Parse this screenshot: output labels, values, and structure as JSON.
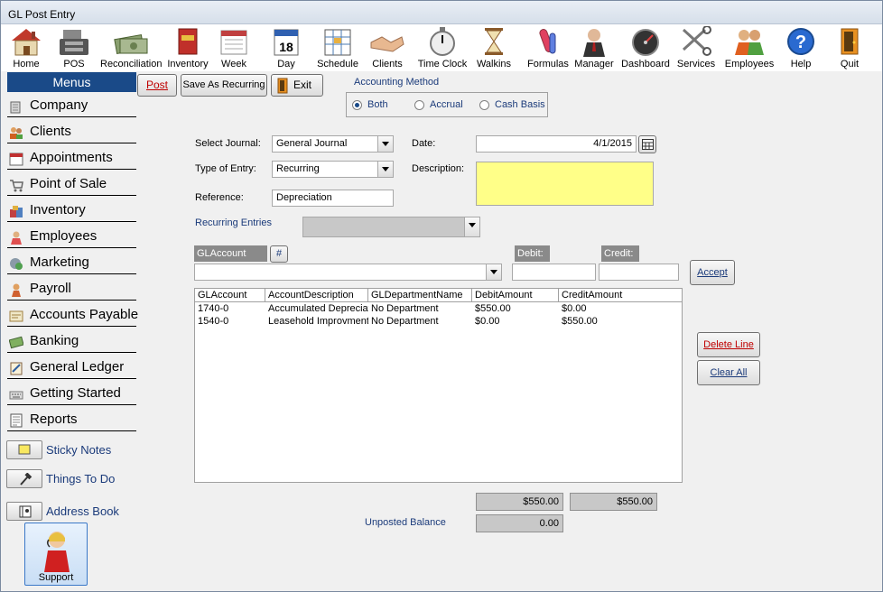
{
  "window": {
    "title": "GL Post Entry"
  },
  "toolbar": [
    {
      "label": "Home",
      "icon": "house-icon"
    },
    {
      "label": "POS",
      "icon": "cash-register-icon"
    },
    {
      "label": "Reconciliation",
      "icon": "money-icon"
    },
    {
      "label": "Inventory",
      "icon": "book-icon"
    },
    {
      "label": "Week",
      "icon": "week-calendar-icon"
    },
    {
      "label": "Day",
      "icon": "day-calendar-icon"
    },
    {
      "label": "Schedule",
      "icon": "schedule-icon"
    },
    {
      "label": "Clients",
      "icon": "handshake-icon"
    },
    {
      "label": "Time Clock",
      "icon": "stopwatch-icon"
    },
    {
      "label": "Walkins",
      "icon": "hourglass-icon"
    },
    {
      "label": "Formulas",
      "icon": "test-tube-icon"
    },
    {
      "label": "Manager",
      "icon": "manager-icon"
    },
    {
      "label": "Dashboard",
      "icon": "gauge-icon"
    },
    {
      "label": "Services",
      "icon": "scissors-icon"
    },
    {
      "label": "Employees",
      "icon": "people-icon"
    },
    {
      "label": "Help",
      "icon": "help-icon"
    },
    {
      "label": "Quit",
      "icon": "door-icon"
    }
  ],
  "sidebar": {
    "header": "Menus",
    "items": [
      {
        "label": "Company",
        "icon": "company-icon"
      },
      {
        "label": "Clients",
        "icon": "clients-icon"
      },
      {
        "label": "Appointments",
        "icon": "appointments-icon"
      },
      {
        "label": "Point of Sale",
        "icon": "cart-icon"
      },
      {
        "label": "Inventory",
        "icon": "inventory-icon"
      },
      {
        "label": "Employees",
        "icon": "employees-icon"
      },
      {
        "label": "Marketing",
        "icon": "marketing-icon"
      },
      {
        "label": "Payroll",
        "icon": "payroll-icon"
      },
      {
        "label": "Accounts Payable",
        "icon": "accounts-payable-icon"
      },
      {
        "label": "Banking",
        "icon": "banking-icon"
      },
      {
        "label": "General Ledger",
        "icon": "ledger-icon"
      },
      {
        "label": "Getting Started",
        "icon": "keyboard-icon"
      },
      {
        "label": "Reports",
        "icon": "reports-icon"
      }
    ],
    "utilities": [
      {
        "label": "Sticky Notes",
        "icon": "sticky-note-icon"
      },
      {
        "label": "Things To Do",
        "icon": "hammer-icon"
      },
      {
        "label": "Address Book",
        "icon": "address-book-icon"
      }
    ],
    "support": "Support"
  },
  "actions": {
    "post": "Post",
    "save_recurring": "Save As Recurring",
    "exit": "Exit"
  },
  "accounting_method": {
    "title": "Accounting Method",
    "options": [
      "Both",
      "Accrual",
      "Cash Basis"
    ],
    "selected": "Both"
  },
  "form": {
    "select_journal_label": "Select Journal:",
    "select_journal_value": "General Journal",
    "type_of_entry_label": "Type of Entry:",
    "type_of_entry_value": "Recurring",
    "reference_label": "Reference:",
    "reference_value": "Depreciation",
    "date_label": "Date:",
    "date_value": "4/1/2015",
    "description_label": "Description:",
    "description_value": "",
    "recurring_entries_label": "Recurring Entries",
    "recurring_entries_value": ""
  },
  "entry": {
    "glaccount_label": "GLAccount",
    "hash_button": "#",
    "debit_label": "Debit:",
    "credit_label": "Credit:",
    "glaccount_value": "",
    "debit_value": "",
    "credit_value": "",
    "accept": "Accept"
  },
  "grid": {
    "columns": [
      "GLAccount",
      "AccountDescription",
      "GLDepartmentName",
      "DebitAmount",
      "CreditAmount"
    ],
    "rows": [
      [
        "1740-0",
        "Accumulated Depreciation",
        "No Department",
        "$550.00",
        "$0.00"
      ],
      [
        "1540-0",
        "Leasehold Improvments",
        "No Department",
        "$0.00",
        "$550.00"
      ]
    ]
  },
  "grid_actions": {
    "delete_line": "Delete Line",
    "clear_all": "Clear All"
  },
  "totals": {
    "debit_total": "$550.00",
    "credit_total": "$550.00",
    "unposted_label": "Unposted Balance",
    "unposted_value": "0.00"
  },
  "colors": {
    "menu_header": "#1a4a88",
    "description_bg": "#ffff88",
    "link_blue": "#1a3a7a"
  }
}
